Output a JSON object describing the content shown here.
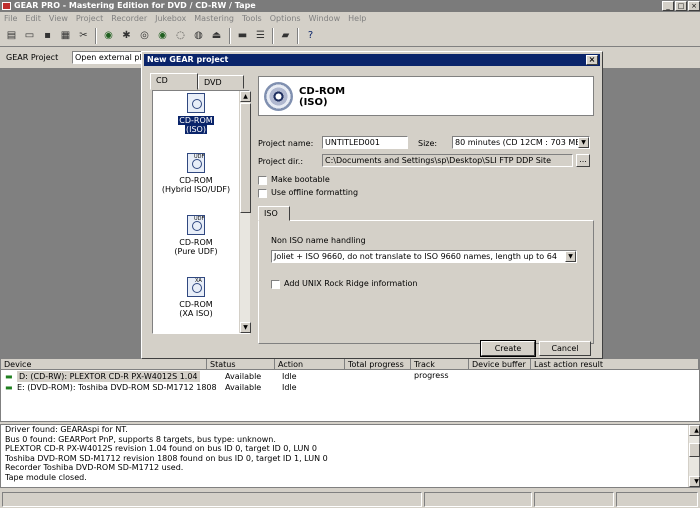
{
  "window": {
    "title": "GEAR PRO - Mastering Edition for DVD / CD-RW / Tape"
  },
  "menu": [
    "File",
    "Edit",
    "View",
    "Project",
    "Recorder",
    "Jukebox",
    "Mastering",
    "Tools",
    "Options",
    "Window",
    "Help"
  ],
  "toolbar2": {
    "label": "GEAR Project",
    "combo_value": "Open external physic"
  },
  "dialog": {
    "title": "New GEAR project",
    "tabs": [
      "CD",
      "DVD"
    ],
    "project_types": [
      {
        "label1": "CD-ROM",
        "label2": "(ISO)",
        "icon": "cd-rom-iso-icon",
        "badge": ""
      },
      {
        "label1": "CD-ROM",
        "label2": "(Hybrid ISO/UDF)",
        "icon": "cd-rom-hybrid-icon",
        "badge": "UDF"
      },
      {
        "label1": "CD-ROM",
        "label2": "(Pure UDF)",
        "icon": "cd-rom-udf-icon",
        "badge": "UDF"
      },
      {
        "label1": "CD-ROM",
        "label2": "(XA ISO)",
        "icon": "cd-rom-xa-icon",
        "badge": "XA"
      }
    ],
    "header": {
      "line1": "CD-ROM",
      "line2": "(ISO)"
    },
    "project_name_label": "Project name:",
    "project_name_value": "UNTITLED001",
    "size_label": "Size:",
    "size_value": "80 minutes  (CD 12CM    : 703 MB)",
    "project_dir_label": "Project dir.:",
    "project_dir_value": "C:\\Documents and Settings\\sp\\Desktop\\SLI FTP DDP Site",
    "browse_label": "...",
    "make_bootable": "Make bootable",
    "offline_formatting": "Use offline formatting",
    "iso_tab": "ISO",
    "non_iso_label": "Non ISO name handling",
    "non_iso_value": "Joliet + ISO 9660, do not translate to ISO 9660 names, length up to 64",
    "unix_rock_ridge": "Add UNIX Rock Ridge information",
    "create_label": "Create",
    "cancel_label": "Cancel"
  },
  "devices": {
    "headers": [
      "Device",
      "Status",
      "Action",
      "Total progress",
      "Track progress",
      "Device buffer",
      "Last action result"
    ],
    "rows": [
      {
        "device": "D: (CD-RW):  PLEXTOR CD-R   PX-W4012S 1.04",
        "status": "Available",
        "action": "Idle"
      },
      {
        "device": "E: (DVD-ROM):  Toshiba DVD-ROM SD-M1712 1808",
        "status": "Available",
        "action": "Idle"
      }
    ]
  },
  "log": [
    "Driver found: GEARAspi for NT.",
    "Bus 0 found: GEARPort PnP, supports 8 targets, bus type: unknown.",
    "PLEXTOR  CD-R   PX-W4012S revision 1.04 found on bus ID 0, target ID 0, LUN 0",
    "Toshiba  DVD-ROM SD-M1712 revision 1808 found on bus ID 0, target ID 1, LUN 0",
    "Recorder Toshiba DVD-ROM SD-M1712 used.",
    "Tape module closed."
  ]
}
